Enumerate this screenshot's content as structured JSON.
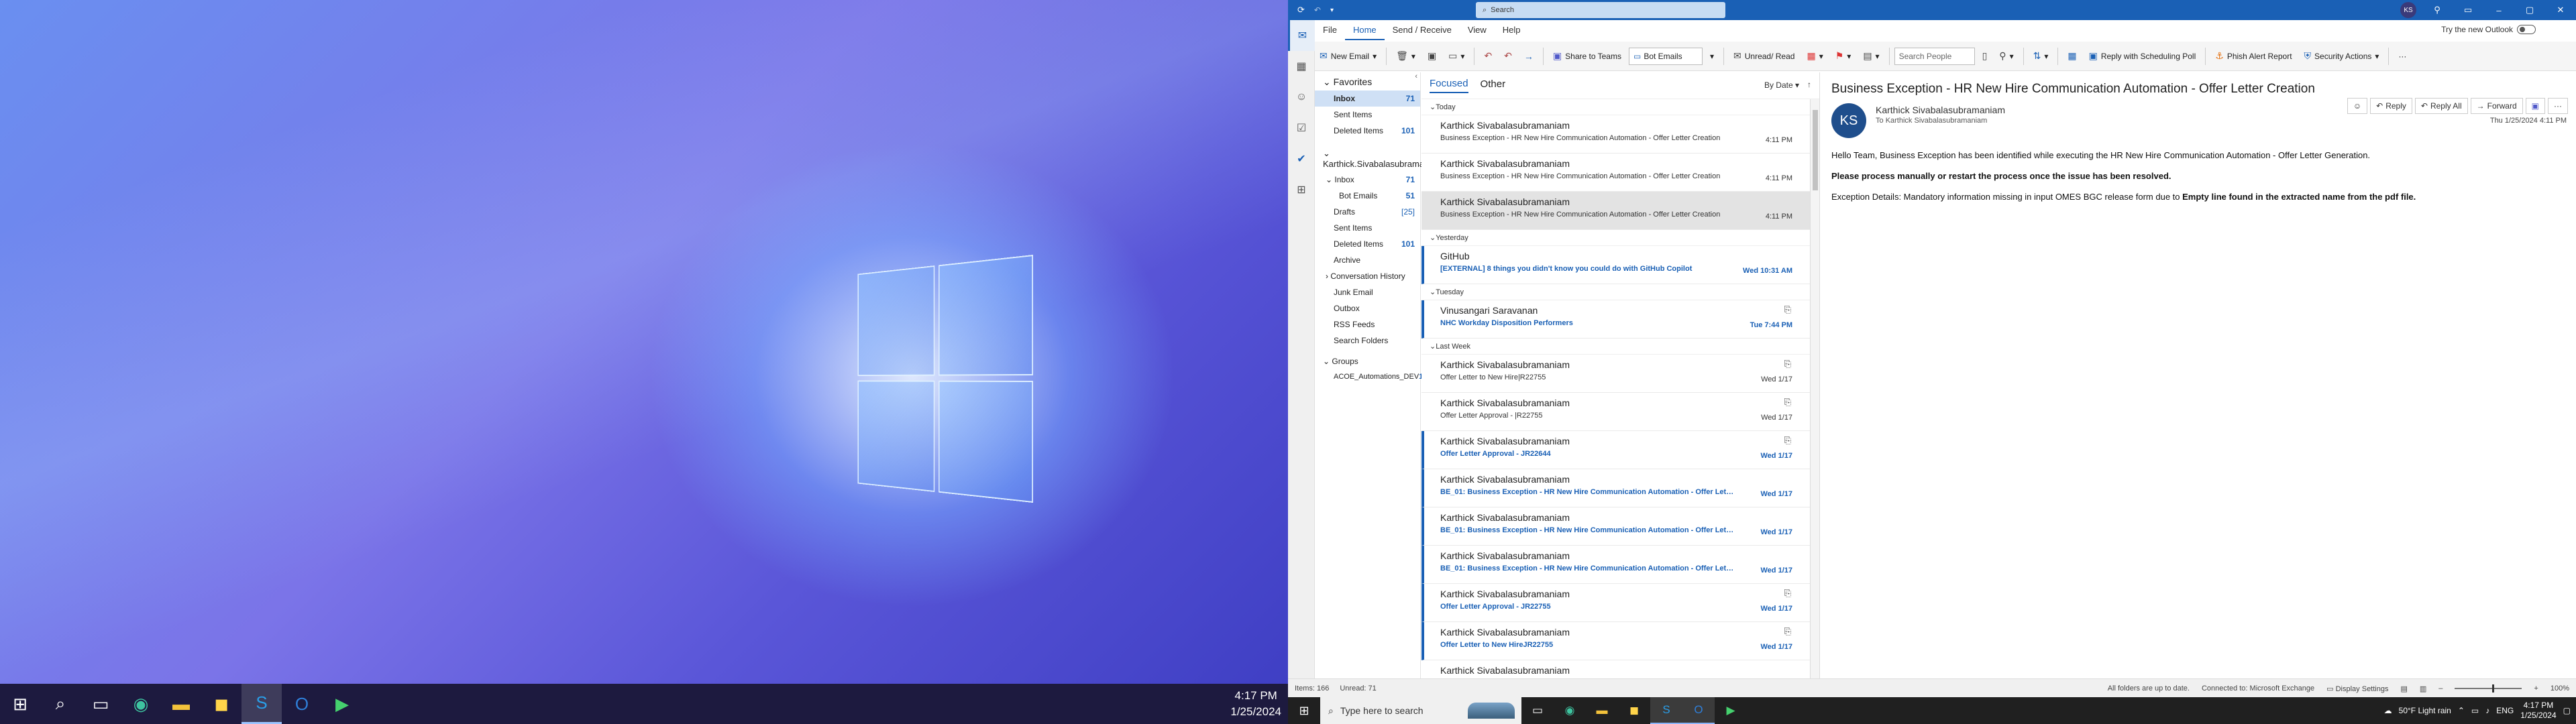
{
  "desktop": {
    "taskbar_icons": [
      "windows-start-icon",
      "search-icon",
      "task-view-icon",
      "edge-icon",
      "file-explorer-icon",
      "store-icon",
      "skype-icon",
      "outlook-icon",
      "media-player-icon"
    ],
    "clock_time": "4:17 PM",
    "clock_date": "1/25/2024"
  },
  "outlook": {
    "titlebar": {
      "search_placeholder": "Search",
      "user_initials": "KS"
    },
    "menu": [
      "File",
      "Home",
      "Send / Receive",
      "View",
      "Help"
    ],
    "active_menu": "Home",
    "try_new_outlook": "Try the new Outlook",
    "ribbon": {
      "new_email": "New Email",
      "share_to_teams": "Share to Teams",
      "quick_step": "Bot Emails",
      "unread_read": "Unread/ Read",
      "search_people": "Search People",
      "reply_scheduling_poll": "Reply with Scheduling Poll",
      "phish_alert": "Phish Alert Report",
      "security_actions": "Security Actions"
    },
    "folders": {
      "favorites_label": "Favorites",
      "favorites": [
        {
          "name": "Inbox",
          "count": "71"
        },
        {
          "name": "Sent Items",
          "count": ""
        },
        {
          "name": "Deleted Items",
          "count": "101"
        }
      ],
      "account_label": "Karthick.Sivabalasubraman...",
      "account_items": [
        {
          "name": "Inbox",
          "count": "71"
        },
        {
          "name": "Bot Emails",
          "count": "51"
        },
        {
          "name": "Drafts",
          "count": "[25]"
        },
        {
          "name": "Sent Items",
          "count": ""
        },
        {
          "name": "Deleted Items",
          "count": "101"
        },
        {
          "name": "Archive",
          "count": ""
        },
        {
          "name": "Conversation History",
          "count": ""
        },
        {
          "name": "Junk Email",
          "count": ""
        },
        {
          "name": "Outbox",
          "count": ""
        },
        {
          "name": "RSS Feeds",
          "count": ""
        },
        {
          "name": "Search Folders",
          "count": ""
        }
      ],
      "groups_label": "Groups",
      "groups": [
        {
          "name": "ACOE_Automations_DEV",
          "count": "1"
        }
      ]
    },
    "list": {
      "tab_focused": "Focused",
      "tab_other": "Other",
      "sort_label": "By Date",
      "groups": [
        {
          "label": "Today",
          "messages": [
            {
              "from": "Karthick Sivabalasubramaniam",
              "subject": "Business Exception - HR New Hire Communication Automation - Offer Letter Creation",
              "time": "4:11 PM",
              "unread": false,
              "selected": false,
              "attachment": false
            },
            {
              "from": "Karthick Sivabalasubramaniam",
              "subject": "Business Exception - HR New Hire Communication Automation - Offer Letter Creation",
              "time": "4:11 PM",
              "unread": false,
              "selected": false,
              "attachment": false
            },
            {
              "from": "Karthick Sivabalasubramaniam",
              "subject": "Business Exception - HR New Hire Communication Automation - Offer Letter Creation",
              "time": "4:11 PM",
              "unread": false,
              "selected": true,
              "attachment": false
            }
          ]
        },
        {
          "label": "Yesterday",
          "messages": [
            {
              "from": "GitHub",
              "subject": "[EXTERNAL] 8 things you didn't know you could do with GitHub Copilot",
              "time": "Wed 10:31 AM",
              "unread": true,
              "selected": false,
              "attachment": false
            }
          ]
        },
        {
          "label": "Tuesday",
          "messages": [
            {
              "from": "Vinusangari Saravanan",
              "subject": "NHC Workday Disposition Performers",
              "time": "Tue 7:44 PM",
              "unread": true,
              "selected": false,
              "attachment": true
            }
          ]
        },
        {
          "label": "Last Week",
          "messages": [
            {
              "from": "Karthick Sivabalasubramaniam",
              "subject": "Offer Letter to New Hire|R22755",
              "time": "Wed 1/17",
              "unread": false,
              "selected": false,
              "attachment": true
            },
            {
              "from": "Karthick Sivabalasubramaniam",
              "subject": "Offer Letter Approval - |R22755",
              "time": "Wed 1/17",
              "unread": false,
              "selected": false,
              "attachment": true
            },
            {
              "from": "Karthick Sivabalasubramaniam",
              "subject": "Offer Letter Approval - JR22644",
              "time": "Wed 1/17",
              "unread": true,
              "selected": false,
              "attachment": true
            },
            {
              "from": "Karthick Sivabalasubramaniam",
              "subject": "BE_01: Business Exception - HR New Hire Communication Automation - Offer Letter Ge...",
              "time": "Wed 1/17",
              "unread": true,
              "selected": false,
              "attachment": false
            },
            {
              "from": "Karthick Sivabalasubramaniam",
              "subject": "BE_01: Business Exception - HR New Hire Communication Automation - Offer Letter Ge...",
              "time": "Wed 1/17",
              "unread": true,
              "selected": false,
              "attachment": false
            },
            {
              "from": "Karthick Sivabalasubramaniam",
              "subject": "BE_01: Business Exception - HR New Hire Communication Automation - Offer Letter Ge...",
              "time": "Wed 1/17",
              "unread": true,
              "selected": false,
              "attachment": false
            },
            {
              "from": "Karthick Sivabalasubramaniam",
              "subject": "Offer Letter Approval - JR22755",
              "time": "Wed 1/17",
              "unread": true,
              "selected": false,
              "attachment": true
            },
            {
              "from": "Karthick Sivabalasubramaniam",
              "subject": "Offer Letter to New HireJR22755",
              "time": "Wed 1/17",
              "unread": true,
              "selected": false,
              "attachment": true
            },
            {
              "from": "Karthick Sivabalasubramaniam",
              "subject": "",
              "time": "",
              "unread": false,
              "selected": false,
              "attachment": false
            }
          ]
        }
      ]
    },
    "reading": {
      "subject": "Business Exception - HR New Hire Communication Automation - Offer Letter Creation",
      "avatar_initials": "KS",
      "sender": "Karthick Sivabalasubramaniam",
      "to_label": "To",
      "to": "Karthick Sivabalasubramaniam",
      "date": "Thu 1/25/2024 4:11 PM",
      "reply": "Reply",
      "reply_all": "Reply All",
      "forward": "Forward",
      "line1": "Hello Team, Business Exception has been identified while executing the HR New Hire Communication Automation - Offer Letter Generation.",
      "line2": "Please process manually or restart the process once the issue has been resolved.",
      "line3_prefix": "Exception Details: Mandatory information missing in input OMES BGC release form due to ",
      "line3_bold": "Empty line found in the extracted name from the pdf file."
    },
    "status": {
      "items": "Items: 166",
      "unread": "Unread: 71",
      "sync": "All folders are up to date.",
      "connection": "Connected to: Microsoft Exchange",
      "display_settings": "Display Settings",
      "zoom": "100%"
    }
  },
  "taskbar2": {
    "search_placeholder": "Type here to search",
    "weather": "50°F  Light rain",
    "lang": "ENG",
    "time": "4:17 PM",
    "date": "1/25/2024"
  }
}
